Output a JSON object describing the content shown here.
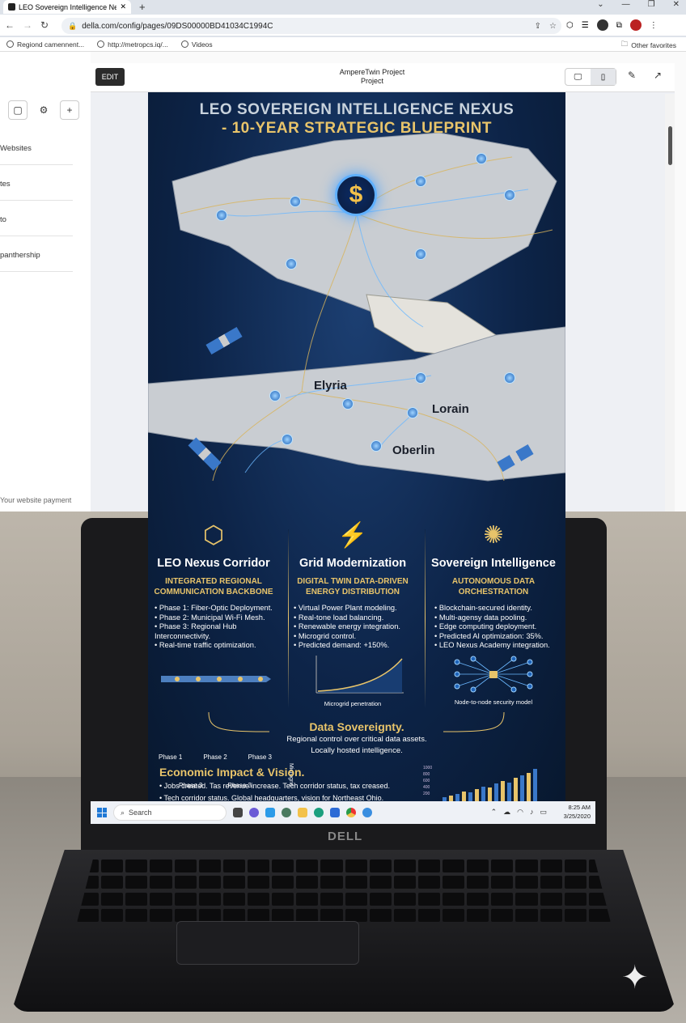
{
  "browser": {
    "tab_title": "LEO Sovereign Intelligence Ne:",
    "new_tab": "+",
    "url": "della.com/config/pages/09DS00000BD41034C1994C",
    "bookmarks": [
      "Regiond camennent...",
      "http://metropcs.iq/...",
      "Videos"
    ],
    "other_favorites": "Other favorites"
  },
  "sidebar": {
    "items": [
      "Websites",
      "tes",
      "to",
      "panthership"
    ],
    "footer": "Your website payment"
  },
  "editor": {
    "edit_label": "EDIT",
    "project_title": "AmpereTwin Project",
    "project_subtitle": "Project"
  },
  "poster": {
    "title_line1": "LEO SOVEREIGN INTELLIGENCE NEXUS",
    "title_line2": "- 10-YEAR STRATEGIC BLUEPRINT",
    "cities": [
      "Elyria",
      "Lorain",
      "Oberlin"
    ],
    "columns": [
      {
        "title": "LEO Nexus Corridor",
        "subtitle": "INTEGRATED REGIONAL COMMUNICATION BACKBONE",
        "items": [
          "Phase 1: Fiber-Optic Deployment.",
          "Phase 2: Municipal Wi-Fi Mesh.",
          "Phase 3: Regional Hub Interconnectivity.",
          "Real-time traffic optimization."
        ],
        "figure_top": [
          "Phase 1",
          "Phase 2",
          "Phase 3"
        ],
        "figure_bottom": [
          "Phase 3",
          "Phase 3"
        ]
      },
      {
        "title": "Grid Modernization",
        "subtitle": "DIGITAL TWIN DATA-DRIVEN ENERGY DISTRIBUTION",
        "items": [
          "Virtual Power Plant modeling.",
          "Real-tone load balancing.",
          "Renewable energy integration.",
          "Microgrid control.",
          "Predicted demand: +150%."
        ],
        "figure_ylabel": "Microgrid",
        "figure_caption": "Microgrid penetration"
      },
      {
        "title": "Sovereign Intelligence",
        "subtitle": "AUTONOMOUS DATA ORCHESTRATION",
        "items": [
          "Blockchain-secured identity.",
          "Multi-agensy data pooling.",
          "Edge computing deployment.",
          "Predicted AI optimization: 35%.",
          "LEO Nexus Academy integration."
        ],
        "figure_caption": "Node-to-node security model"
      }
    ],
    "sovereignty": {
      "title": "Data Sovereignty.",
      "line1": "Regional control over critical data assets.",
      "line2": "Locally hosted intelligence."
    },
    "economic": {
      "title": "Economic Impact & Vision.",
      "line1": "• Jobs created. Tas revenue increase. Tech corridor status, tax creased.",
      "line2": "• Tech corridor status. Global headquarters, vision for Northeast Ohio.",
      "chart_ticks": [
        "1000",
        "800",
        "600",
        "400",
        "200"
      ],
      "chart_values": [
        0.12,
        0.18,
        0.22,
        0.3,
        0.28,
        0.38,
        0.45,
        0.42,
        0.55,
        0.62,
        0.58,
        0.72,
        0.8,
        0.88,
        1.0
      ]
    }
  },
  "taskbar": {
    "search_placeholder": "Search",
    "time": "8:25 AM",
    "date": "3/25/2020"
  },
  "laptop": {
    "brand": "DELL"
  }
}
